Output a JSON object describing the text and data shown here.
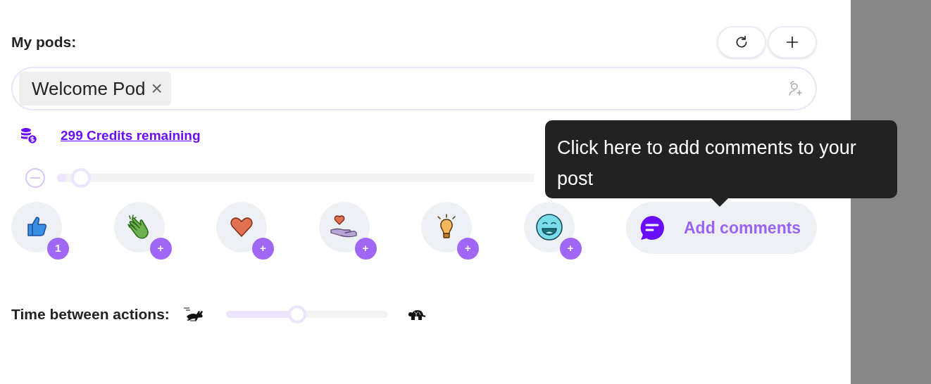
{
  "pods": {
    "title": "My pods:",
    "chips": [
      {
        "label": "Welcome Pod",
        "remove": "×"
      }
    ]
  },
  "credits": {
    "link": "299 Credits remaining"
  },
  "amount_slider": {
    "level": 0.02
  },
  "reactions": [
    {
      "kind": "like",
      "badge": "1"
    },
    {
      "kind": "clap",
      "badge": "+"
    },
    {
      "kind": "heart",
      "badge": "+"
    },
    {
      "kind": "support",
      "badge": "+"
    },
    {
      "kind": "idea",
      "badge": "+"
    },
    {
      "kind": "laugh",
      "badge": "+"
    }
  ],
  "add_comments": {
    "label": "Add comments"
  },
  "tooltip": {
    "text": "Click here to add comments to your post"
  },
  "timing": {
    "label": "Time between actions:",
    "level": 0.44
  }
}
